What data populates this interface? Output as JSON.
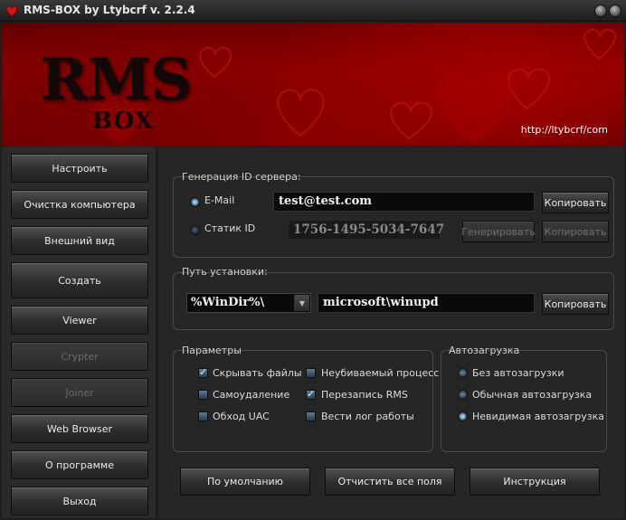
{
  "window": {
    "title": "RMS-BOX by Ltybcrf v. 2.2.4"
  },
  "banner": {
    "logo_main": "RMS",
    "logo_sub": "BOX",
    "url": "http://ltybcrf/com"
  },
  "sidebar": {
    "items": [
      {
        "label": "Настроить",
        "enabled": true
      },
      {
        "label": "Очистка компьютера",
        "enabled": true
      },
      {
        "label": "Внешний вид",
        "enabled": true
      },
      {
        "label": "Создать",
        "enabled": true
      },
      {
        "label": "Viewer",
        "enabled": true
      },
      {
        "label": "Crypter",
        "enabled": false
      },
      {
        "label": "Joiner",
        "enabled": false
      },
      {
        "label": "Web Browser",
        "enabled": true
      },
      {
        "label": "О программе",
        "enabled": true
      },
      {
        "label": "Выход",
        "enabled": true
      }
    ]
  },
  "server_id": {
    "group_label": "Генерация ID сервера:",
    "email_label": "E-Mail",
    "email_value": "test@test.com",
    "email_selected": true,
    "static_label": "Статик ID",
    "static_value": "1756-1495-5034-7647",
    "static_selected": false,
    "copy_label": "Копировать",
    "generate_label": "Генерировать"
  },
  "install_path": {
    "group_label": "Путь установки:",
    "base_dir": "%WinDir%\\",
    "subdir": "microsoft\\winupd",
    "copy_label": "Копировать"
  },
  "parameters": {
    "group_label": "Параметры",
    "options": [
      {
        "label": "Скрывать файлы",
        "checked": true
      },
      {
        "label": "Неубиваемый процесс",
        "checked": false
      },
      {
        "label": "Самоудаление",
        "checked": false
      },
      {
        "label": "Перезапись RMS",
        "checked": true
      },
      {
        "label": "Обход UAC",
        "checked": false
      },
      {
        "label": "Вести лог работы",
        "checked": false
      }
    ]
  },
  "autorun": {
    "group_label": "Автозагрузка",
    "options": [
      {
        "label": "Без автозагрузки",
        "selected": false
      },
      {
        "label": "Обычная автозагрузка",
        "selected": false
      },
      {
        "label": "Невидимая автозагрузка",
        "selected": true
      }
    ]
  },
  "footer": {
    "defaults_label": "По умолчанию",
    "clear_label": "Отчистить все поля",
    "help_label": "Инструкция"
  },
  "colors": {
    "banner_red": "#8e0000",
    "panel_bg": "#262626",
    "accent_radio": "#7aa6c8"
  }
}
